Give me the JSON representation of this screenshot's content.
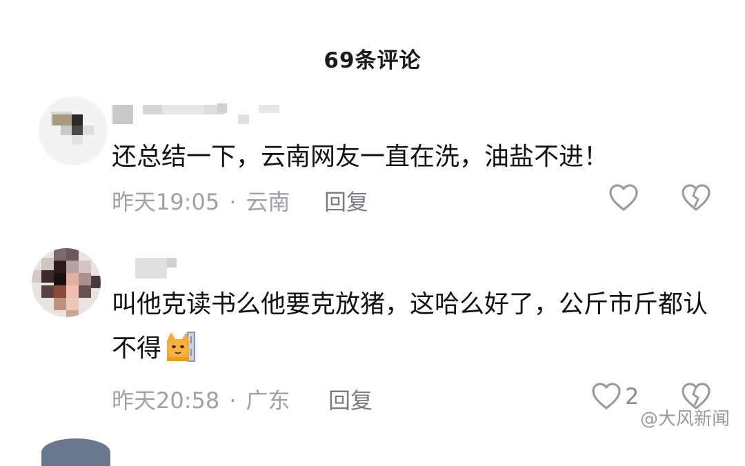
{
  "header": {
    "title": "69条评论"
  },
  "comments": [
    {
      "text": "还总结一下，云南网友一直在洗，油盐不进！",
      "time": "昨天19:05",
      "location": "云南",
      "reply_label": "回复",
      "likes": ""
    },
    {
      "text": "叫他克读书么他要克放猪，这哈么好了，公斤市斤都认不得",
      "time": "昨天20:58",
      "location": "广东",
      "reply_label": "回复",
      "likes": "2"
    }
  ],
  "separator": "·",
  "watermark": "@大风新闻",
  "icons": {
    "like": "heart-outline-icon",
    "dislike": "broken-heart-icon",
    "emoji": "cat-emoji-icon"
  }
}
